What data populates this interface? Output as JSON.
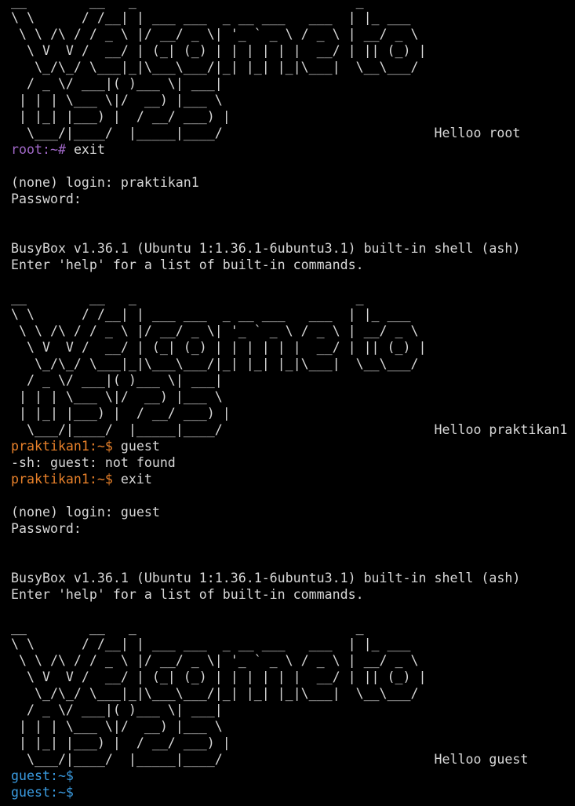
{
  "terminal": {
    "colors": {
      "background": "#000000",
      "foreground": "#d8d8d8",
      "root_prompt": "#a168c8",
      "praktikan_prompt": "#e8812a",
      "guest_prompt": "#3a9be0"
    },
    "banner_art": [
      "__        __   _                            _        ",
      "\\ \\      / /__| | ___ ___  _ __ ___   ___  | |_ ___  ",
      " \\ \\ /\\ / / _ \\ |/ __/ _ \\| '_ ` _ \\ / _ \\ | __/ _ \\ ",
      "  \\ V  V /  __/ | (_| (_) | | | | | |  __/ | || (_) |",
      "   \\_/\\_/ \\___|_|\\___\\___/|_| |_| |_|\\___|  \\__\\___/ ",
      "  / _ \\/ ___|( )___ \\| ___|",
      " | | | \\___ \\|/  __) |___ \\",
      " | |_| |___) |  / __/ ___) |",
      "  \\___/|____/  |_____|____/"
    ],
    "greetings": {
      "root": "Helloo root",
      "praktikan1": "Helloo praktikan1",
      "guest": "Helloo guest"
    },
    "prompts": {
      "root": "root:~#",
      "praktikan1": "praktikan1:~$",
      "guest": "guest:~$"
    },
    "commands": {
      "exit": "exit",
      "guest": "guest"
    },
    "messages": {
      "login_praktikan": "(none) login: praktikan1",
      "login_guest": "(none) login: guest",
      "password": "Password:",
      "busybox": "BusyBox v1.36.1 (Ubuntu 1:1.36.1-6ubuntu3.1) built-in shell (ash)",
      "help": "Enter 'help' for a list of built-in commands.",
      "not_found": "-sh: guest: not found"
    }
  }
}
